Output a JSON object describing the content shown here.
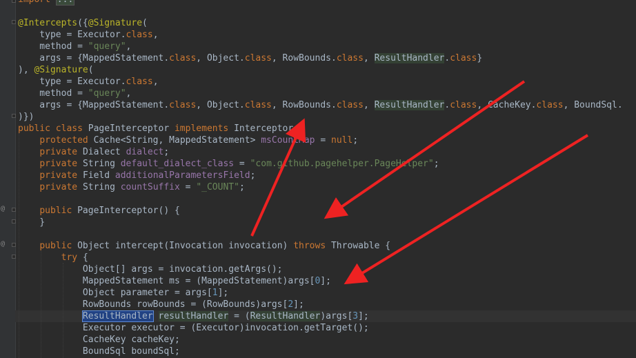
{
  "annotation_color": "#ee2222",
  "lines": [
    [
      [
        "kw",
        "import "
      ],
      [
        "fold",
        "..."
      ]
    ],
    [
      [
        "plain",
        ""
      ]
    ],
    [
      [
        "ann",
        "@Intercepts"
      ],
      [
        "plain",
        "({"
      ],
      [
        "ann",
        "@Signature"
      ],
      [
        "plain",
        "("
      ]
    ],
    [
      [
        "plain",
        "    type = Executor."
      ],
      [
        "kw",
        "class"
      ],
      [
        "plain",
        ","
      ]
    ],
    [
      [
        "plain",
        "    method = "
      ],
      [
        "str",
        "\"query\""
      ],
      [
        "plain",
        ","
      ]
    ],
    [
      [
        "plain",
        "    args = {MappedStatement."
      ],
      [
        "kw",
        "class"
      ],
      [
        "plain",
        ", Object."
      ],
      [
        "kw",
        "class"
      ],
      [
        "plain",
        ", RowBounds."
      ],
      [
        "kw",
        "class"
      ],
      [
        "plain",
        ", "
      ],
      [
        "hrh",
        "ResultHandler"
      ],
      [
        "plain",
        "."
      ],
      [
        "kw",
        "class"
      ],
      [
        "plain",
        "}"
      ]
    ],
    [
      [
        "plain",
        "), "
      ],
      [
        "ann",
        "@Signature"
      ],
      [
        "plain",
        "("
      ]
    ],
    [
      [
        "plain",
        "    type = Executor."
      ],
      [
        "kw",
        "class"
      ],
      [
        "plain",
        ","
      ]
    ],
    [
      [
        "plain",
        "    method = "
      ],
      [
        "str",
        "\"query\""
      ],
      [
        "plain",
        ","
      ]
    ],
    [
      [
        "plain",
        "    args = {MappedStatement."
      ],
      [
        "kw",
        "class"
      ],
      [
        "plain",
        ", Object."
      ],
      [
        "kw",
        "class"
      ],
      [
        "plain",
        ", RowBounds."
      ],
      [
        "kw",
        "class"
      ],
      [
        "plain",
        ", "
      ],
      [
        "hrh",
        "ResultHandler"
      ],
      [
        "plain",
        "."
      ],
      [
        "kw",
        "class"
      ],
      [
        "plain",
        ", CacheKey."
      ],
      [
        "kw",
        "class"
      ],
      [
        "plain",
        ", BoundSql."
      ]
    ],
    [
      [
        "plain",
        ")})"
      ]
    ],
    [
      [
        "kw",
        "public class "
      ],
      [
        "plain",
        "PageInterceptor "
      ],
      [
        "kw",
        "implements "
      ],
      [
        "plain",
        "Interceptor {"
      ]
    ],
    [
      [
        "plain",
        "    "
      ],
      [
        "kw",
        "protected "
      ],
      [
        "plain",
        "Cache<String, MappedStatement> "
      ],
      [
        "fld",
        "msCountMap"
      ],
      [
        "plain",
        " = "
      ],
      [
        "kw",
        "null"
      ],
      [
        "plain",
        ";"
      ]
    ],
    [
      [
        "plain",
        "    "
      ],
      [
        "kw",
        "private "
      ],
      [
        "plain",
        "Dialect "
      ],
      [
        "fld",
        "dialect"
      ],
      [
        "plain",
        ";"
      ]
    ],
    [
      [
        "plain",
        "    "
      ],
      [
        "kw",
        "private "
      ],
      [
        "plain",
        "String "
      ],
      [
        "fld",
        "default_dialect_class"
      ],
      [
        "plain",
        " = "
      ],
      [
        "str",
        "\"com.github.pagehelper.PageHelper\""
      ],
      [
        "plain",
        ";"
      ]
    ],
    [
      [
        "plain",
        "    "
      ],
      [
        "kw",
        "private "
      ],
      [
        "plain",
        "Field "
      ],
      [
        "fld",
        "additionalParametersField"
      ],
      [
        "plain",
        ";"
      ]
    ],
    [
      [
        "plain",
        "    "
      ],
      [
        "kw",
        "private "
      ],
      [
        "plain",
        "String "
      ],
      [
        "fld",
        "countSuffix"
      ],
      [
        "plain",
        " = "
      ],
      [
        "str",
        "\"_COUNT\""
      ],
      [
        "plain",
        ";"
      ]
    ],
    [
      [
        "plain",
        ""
      ]
    ],
    [
      [
        "plain",
        "    "
      ],
      [
        "kw",
        "public "
      ],
      [
        "plain",
        "PageInterceptor() {"
      ]
    ],
    [
      [
        "plain",
        "    }"
      ]
    ],
    [
      [
        "plain",
        ""
      ]
    ],
    [
      [
        "plain",
        "    "
      ],
      [
        "kw",
        "public "
      ],
      [
        "plain",
        "Object intercept(Invocation invocation) "
      ],
      [
        "kw",
        "throws "
      ],
      [
        "plain",
        "Throwable {"
      ]
    ],
    [
      [
        "plain",
        "        "
      ],
      [
        "kw",
        "try "
      ],
      [
        "plain",
        "{"
      ]
    ],
    [
      [
        "plain",
        "            Object[] args = invocation.getArgs();"
      ]
    ],
    [
      [
        "plain",
        "            MappedStatement ms = (MappedStatement)args["
      ],
      [
        "num",
        "0"
      ],
      [
        "plain",
        "];"
      ]
    ],
    [
      [
        "plain",
        "            Object parameter = args["
      ],
      [
        "num",
        "1"
      ],
      [
        "plain",
        "];"
      ]
    ],
    [
      [
        "plain",
        "            RowBounds rowBounds = (RowBounds)args["
      ],
      [
        "num",
        "2"
      ],
      [
        "plain",
        "];"
      ]
    ],
    [
      [
        "plain",
        "            "
      ],
      [
        "sel",
        "ResultHandler"
      ],
      [
        "plain",
        " "
      ],
      [
        "hrh",
        "resultHandler"
      ],
      [
        "plain",
        " = ("
      ],
      [
        "hrh",
        "ResultHandler"
      ],
      [
        "plain",
        ")args["
      ],
      [
        "num",
        "3"
      ],
      [
        "plain",
        "];"
      ]
    ],
    [
      [
        "plain",
        "            Executor executor = (Executor)invocation.getTarget();"
      ]
    ],
    [
      [
        "plain",
        "            CacheKey cacheKey;"
      ]
    ],
    [
      [
        "plain",
        "            BoundSql boundSql;"
      ]
    ]
  ]
}
